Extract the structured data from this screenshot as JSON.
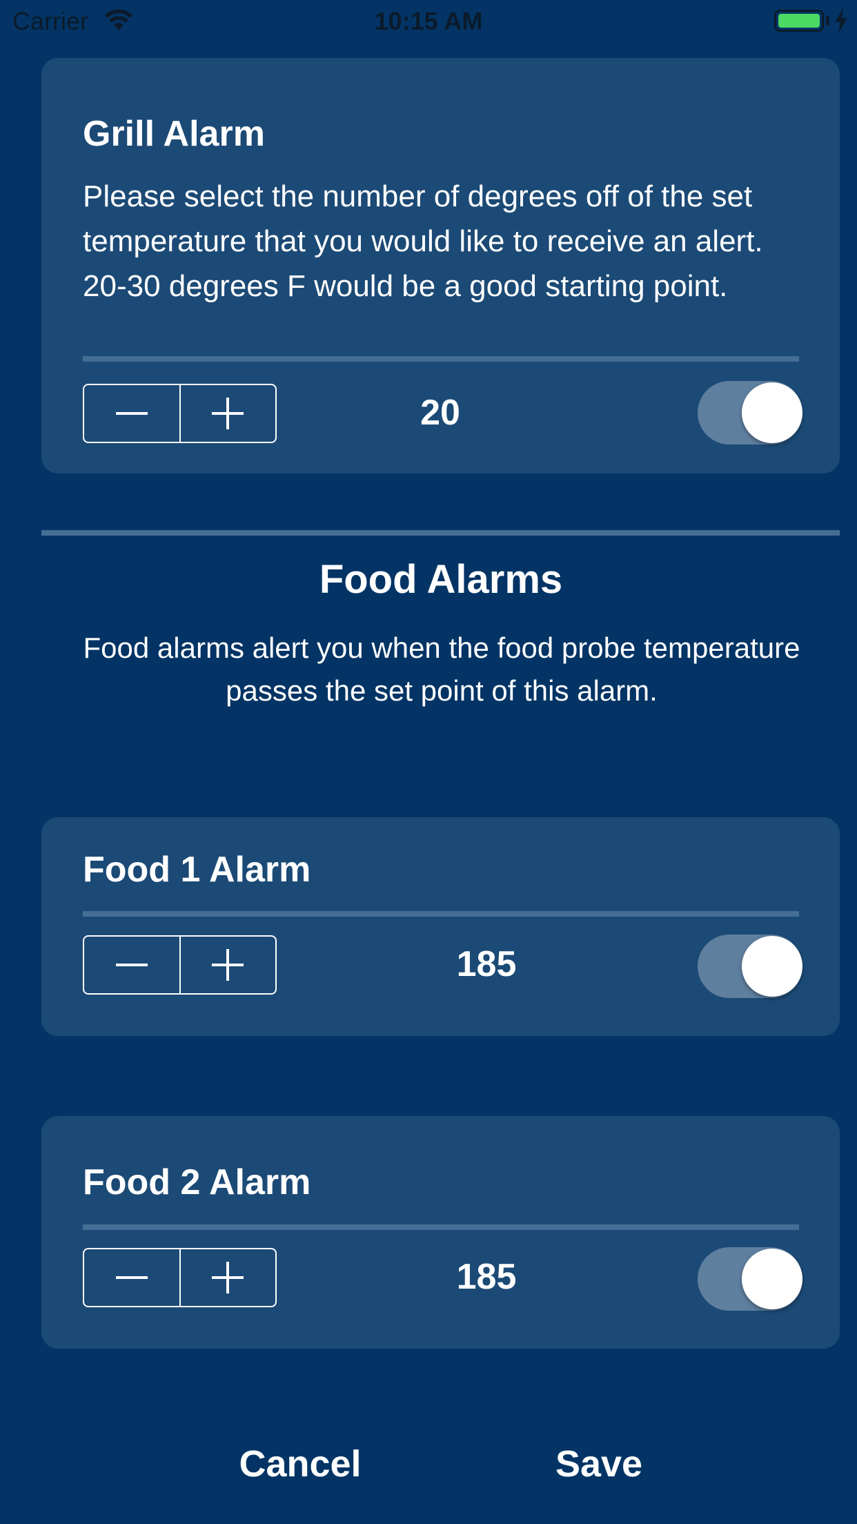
{
  "status_bar": {
    "carrier": "Carrier",
    "time": "10:15 AM",
    "battery_color": "#4cd964"
  },
  "grill_alarm": {
    "title": "Grill Alarm",
    "description": "Please select the number of degrees off of the set temperature that you would like to receive an alert. 20-30 degrees F would be a good starting point.",
    "value": "20",
    "enabled": true
  },
  "food_section": {
    "title": "Food Alarms",
    "description": "Food alarms alert you when the food probe temperature passes the set point of this alarm."
  },
  "food1_alarm": {
    "title": "Food 1 Alarm",
    "value": "185",
    "enabled": true
  },
  "food2_alarm": {
    "title": "Food 2 Alarm",
    "value": "185",
    "enabled": true
  },
  "footer": {
    "cancel_label": "Cancel",
    "save_label": "Save"
  },
  "colors": {
    "background": "#033465",
    "card": "#1c4a76",
    "divider": "#456e95",
    "toggle_track": "#5f7f9f"
  },
  "icons": {
    "stepper_minus": "minus-icon",
    "stepper_plus": "plus-icon",
    "wifi": "wifi-icon",
    "battery": "battery-icon",
    "charging": "charging-bolt-icon"
  }
}
